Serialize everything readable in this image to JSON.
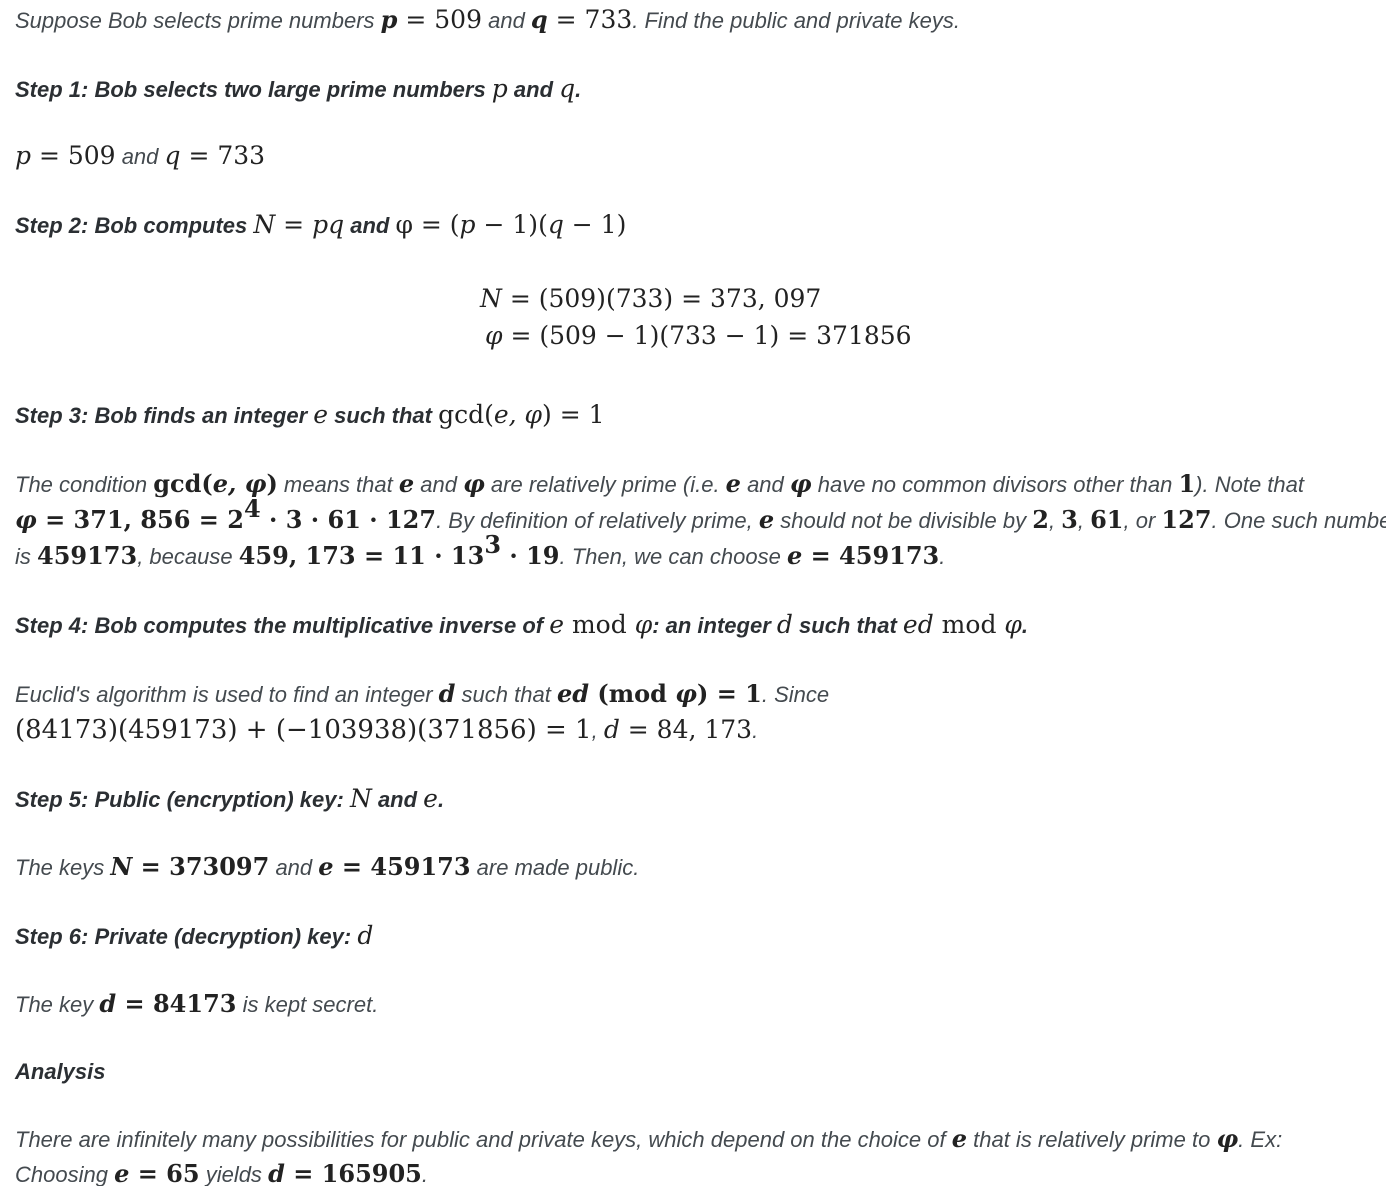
{
  "problem": {
    "t1": "Suppose Bob selects prime numbers ",
    "p": "p",
    "eq1": " = 509",
    "t2": " and ",
    "q": "q",
    "eq2": " = 733",
    "t3": ". Find the public and private keys."
  },
  "step1": {
    "heading_a": "Step 1: Bob selects two large prime numbers ",
    "p": "p",
    "heading_b": " and ",
    "q": "q",
    "heading_c": ".",
    "line_p": "p",
    "line_eq1": " = 509",
    "line_and": " and ",
    "line_q": "q",
    "line_eq2": " = 733"
  },
  "step2": {
    "heading_a": "Step 2: Bob computes ",
    "N": "N",
    "eq_a": " = ",
    "pq": "pq",
    "heading_b": " and ",
    "phi_expr": "φ = (",
    "pm1": "p",
    "mid": " − 1)(",
    "qm1": "q",
    "end": " − 1)",
    "N_line_var": "N",
    "N_line_expr": " = (509)(733) = 373, 097",
    "phi_line_var": "φ",
    "phi_line_expr": " = (509 − 1)(733 − 1) = 371856"
  },
  "step3": {
    "heading_a": "Step 3: Bob finds an integer ",
    "e": "e",
    "heading_b": " such that ",
    "gcd": "gcd(",
    "gcd_vars": "e, φ",
    "gcd_end": ") = 1",
    "p1a": "The condition ",
    "p1_gcd": "gcd(",
    "p1_vars": "e, φ",
    "p1_close": ")",
    "p1b": " means that ",
    "p1_e": "e",
    "p1c": " and ",
    "p1_phi": "φ",
    "p1d": " are relatively prime (i.e. ",
    "p1_e2": "e",
    "p1e": " and ",
    "p1_phi2": "φ",
    "p1f": " have no common divisors other than ",
    "p1_one": "1",
    "p1g": "). Note that",
    "p2_phi": "φ",
    "p2_expr": " = 371, 856 = 2",
    "p2_sup": "4",
    "p2_rest": " · 3 · 61 · 127",
    "p2a": ". By definition of relatively prime, ",
    "p2_e": "e",
    "p2b": " should not be divisible by ",
    "p2_n1": "2",
    "p2c": ", ",
    "p2_n2": "3",
    "p2d": ", ",
    "p2_n3": "61",
    "p2e": ", or ",
    "p2_n4": "127",
    "p2f": ". One such number",
    "p3a": "is ",
    "p3_num": "459173",
    "p3b": ", because ",
    "p3_expr": "459, 173 = 11 · 13",
    "p3_sup": "3",
    "p3_rest": " · 19",
    "p3c": ". Then, we can choose ",
    "p3_e": "e",
    "p3_eq": " = 459173",
    "p3d": "."
  },
  "step4": {
    "heading_a": "Step 4: Bob computes the multiplicative inverse of ",
    "e": "e",
    "mod": " mod ",
    "phi": "φ",
    "heading_b": ": an integer ",
    "d": "d",
    "heading_c": " such that ",
    "ed": "ed",
    "mod2": " mod ",
    "phi2": "φ",
    "heading_d": ".",
    "p1a": "Euclid's algorithm is used to find an integer ",
    "p1_d": "d",
    "p1b": " such that ",
    "p1_ed": "ed",
    "p1_mod": " (mod ",
    "p1_phi": "φ",
    "p1_end": ") = 1",
    "p1c": ". Since",
    "p2_expr": "(84173)(459173) + (−103938)(371856) = 1",
    "p2a": ", ",
    "p2_d": "d",
    "p2_eq": " = 84, 173",
    "p2b": "."
  },
  "step5": {
    "heading_a": "Step 5: Public (encryption) key: ",
    "N": "N",
    "heading_b": " and ",
    "e": "e",
    "heading_c": ".",
    "p_a": "The keys ",
    "p_N": "N",
    "p_eqN": " = 373097",
    "p_b": " and ",
    "p_e": "e",
    "p_eqe": " = 459173",
    "p_c": " are made public."
  },
  "step6": {
    "heading_a": "Step 6: Private (decryption) key: ",
    "d": "d",
    "p_a": "The key ",
    "p_d": "d",
    "p_eq": " = 84173",
    "p_b": " is kept secret."
  },
  "analysis": {
    "heading": "Analysis",
    "p1a": "There are infinitely many possibilities for public and private keys, which depend on the choice of ",
    "p1_e": "e",
    "p1b": " that is relatively prime to ",
    "p1_phi": "φ",
    "p1c": ". Ex:",
    "p2a": "Choosing ",
    "p2_e": "e",
    "p2_eq": " = 65",
    "p2b": " yields ",
    "p2_d": "d",
    "p2_eqd": " = 165905",
    "p2c": "."
  }
}
